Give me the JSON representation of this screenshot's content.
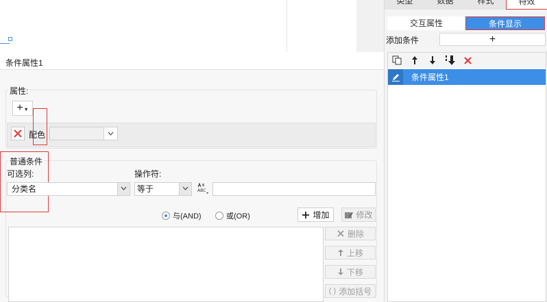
{
  "top_tabs": [
    {
      "label": "类型"
    },
    {
      "label": "数据"
    },
    {
      "label": "样式"
    },
    {
      "label": "特效"
    }
  ],
  "subtabs": {
    "interactive": "交互属性",
    "conditional": "条件显示"
  },
  "add_condition": {
    "label": "添加条件",
    "button": "+"
  },
  "condition_list": {
    "toolbar": [
      "copy-icon",
      "arrow-up-icon",
      "arrow-down-icon",
      "move-bottom-icon",
      "delete-icon"
    ],
    "items": [
      {
        "label": "条件属性1"
      }
    ]
  },
  "dialog": {
    "title": "条件属性1",
    "properties": {
      "legend": "属性:",
      "add_button": "+",
      "row": {
        "name": "配色",
        "value": ""
      }
    },
    "condition": {
      "legend": "普通条件",
      "column_label": "可选列:",
      "column_value": "分类名",
      "operator_label": "操作符:",
      "operator_value": "等于",
      "value_input": "",
      "radio_and": "与(AND)",
      "radio_or": "或(OR)",
      "add_button": "增加",
      "edit_button": "修改",
      "side_buttons": {
        "delete": "删除",
        "move_up": "上移",
        "move_down": "下移",
        "add_parens": "添加括号"
      }
    }
  },
  "colors": {
    "accent": "#3d8ee6",
    "highlight_outline": "#e03a3a"
  }
}
